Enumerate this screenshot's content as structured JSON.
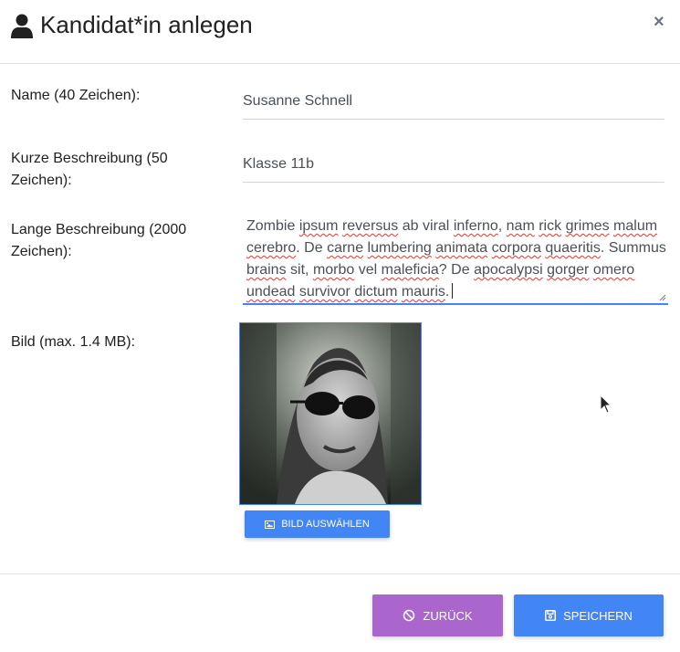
{
  "dialog": {
    "title": "Kandidat*in anlegen",
    "close_label": "×"
  },
  "form": {
    "name": {
      "label": "Name (40 Zeichen):",
      "value": "Susanne Schnell"
    },
    "short_description": {
      "label": "Kurze Beschreibung (50 Zeichen):",
      "value": "Klasse 11b"
    },
    "long_description": {
      "label": "Lange Beschreibung (2000 Zeichen):",
      "value": "Zombie ipsum reversus ab viral inferno, nam rick grimes malum cerebro. De carne lumbering animata corpora quaeritis. Summus brains sit, morbo vel maleficia? De apocalypsi gorger omero undead survivor dictum mauris."
    },
    "image": {
      "label": "Bild (max. 1.4 MB):",
      "select_button": "BILD AUSWÄHLEN"
    }
  },
  "footer": {
    "back_label": "ZURÜCK",
    "save_label": "SPEICHERN"
  },
  "icons": {
    "title": "user-icon",
    "close": "close-icon",
    "select_image": "image-icon",
    "back": "ban-icon",
    "save": "save-icon"
  },
  "colors": {
    "primary": "#4285f4",
    "secondary": "#aa66cc",
    "text": "#212121"
  }
}
